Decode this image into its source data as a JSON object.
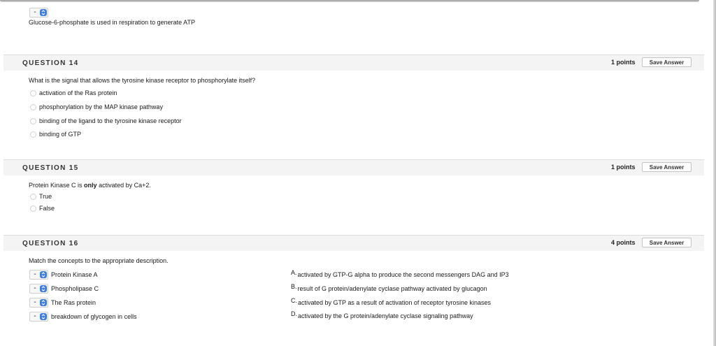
{
  "previous": {
    "select_value": "-",
    "text": "Glucose-6-phosphate is used in respiration to generate ATP"
  },
  "q14": {
    "title": "QUESTION 14",
    "points": "1 points",
    "save": "Save Answer",
    "prompt": "What is the signal that allows the tyrosine kinase receptor to phosphorylate itself?",
    "options": [
      "activation of the Ras protein",
      "phosphorylation by the MAP kinase pathway",
      "binding of the ligand to the tyrosine kinase receptor",
      "binding of GTP"
    ]
  },
  "q15": {
    "title": "QUESTION 15",
    "points": "1 points",
    "save": "Save Answer",
    "prompt_pre": "Protein Kinase C is ",
    "prompt_bold": "only",
    "prompt_post": " activated by Ca+2.",
    "options": [
      "True",
      "False"
    ]
  },
  "q16": {
    "title": "QUESTION 16",
    "points": "4 points",
    "save": "Save Answer",
    "prompt": "Match the concepts to the appropriate description.",
    "items": [
      {
        "select": "-",
        "label": "Protein Kinase A"
      },
      {
        "select": "-",
        "label": "Phospholipase C"
      },
      {
        "select": "-",
        "label": "The Ras protein"
      },
      {
        "select": "-",
        "label": "breakdown of glycogen in cells"
      }
    ],
    "answers": [
      {
        "letter": "A.",
        "text": "activated by GTP-G alpha to produce the second messengers DAG and IP3"
      },
      {
        "letter": "B.",
        "text": "result of G protein/adenylate cyclase pathway activated by glucagon"
      },
      {
        "letter": "C.",
        "text": "activated by GTP as a result of activation of receptor tyrosine kinases"
      },
      {
        "letter": "D.",
        "text": "activated by the G protein/adenylate cyclase signaling pathway"
      }
    ]
  },
  "colors": {
    "select_accent": "#3b7de0",
    "header_bg": "#f4f4f4"
  },
  "icons": {
    "select_arrows": "chevron-updown-icon",
    "radio": "radio-circle"
  }
}
